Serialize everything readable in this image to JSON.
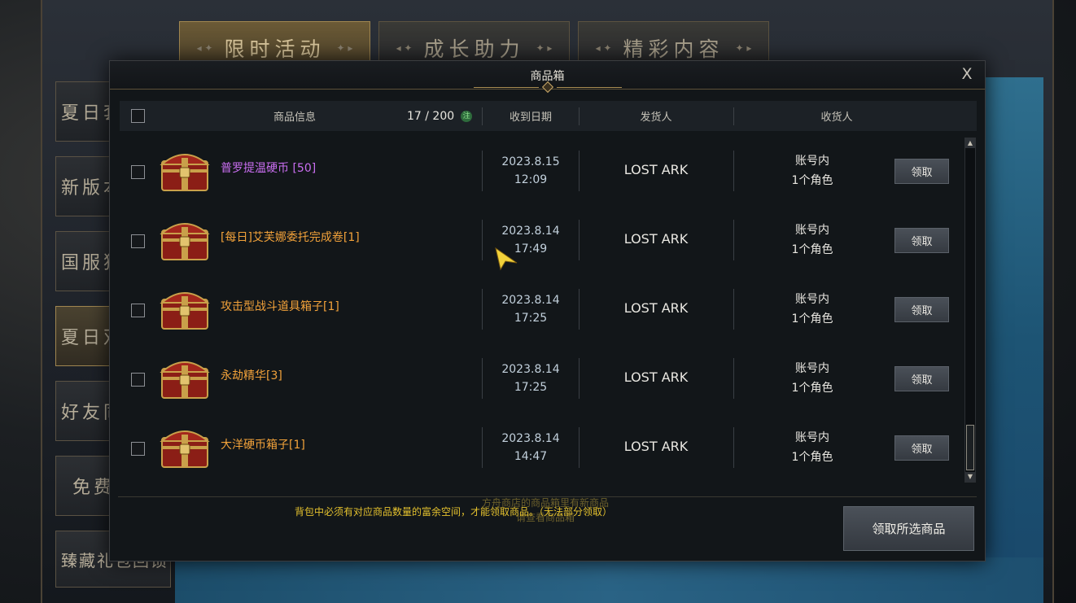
{
  "background": {
    "tabs": [
      {
        "label": "限时活动",
        "active": true
      },
      {
        "label": "成长助力",
        "active": false
      },
      {
        "label": "精彩内容",
        "active": false
      }
    ],
    "side_items": [
      {
        "label": "夏日套",
        "active": false
      },
      {
        "label": "新版本",
        "active": false
      },
      {
        "label": "国服独",
        "active": false
      },
      {
        "label": "夏日双",
        "active": true
      },
      {
        "label": "好友同",
        "active": false
      },
      {
        "label": "免费",
        "active": false
      },
      {
        "label": "臻藏礼包回馈",
        "active": false
      }
    ]
  },
  "modal": {
    "title": "商品箱",
    "close_label": "X",
    "columns": {
      "info": "商品信息",
      "count": "17 / 200",
      "count_note": "注",
      "date": "收到日期",
      "sender": "发货人",
      "receiver": "收货人"
    },
    "rows": [
      {
        "name": "普罗提温硬币 [50]",
        "color": "purple",
        "date": "2023.8.15",
        "time": "12:09",
        "sender": "LOST ARK",
        "receiver_line1": "账号内",
        "receiver_line2": "1个角色",
        "claim": "领取"
      },
      {
        "name": "[每日]艾芙娜委托完成卷[1]",
        "color": "orange",
        "date": "2023.8.14",
        "time": "17:49",
        "sender": "LOST ARK",
        "receiver_line1": "账号内",
        "receiver_line2": "1个角色",
        "claim": "领取"
      },
      {
        "name": "攻击型战斗道具箱子[1]",
        "color": "orange",
        "date": "2023.8.14",
        "time": "17:25",
        "sender": "LOST ARK",
        "receiver_line1": "账号内",
        "receiver_line2": "1个角色",
        "claim": "领取"
      },
      {
        "name": "永劫精华[3]",
        "color": "orange",
        "date": "2023.8.14",
        "time": "17:25",
        "sender": "LOST ARK",
        "receiver_line1": "账号内",
        "receiver_line2": "1个角色",
        "claim": "领取"
      },
      {
        "name": "大洋硬币箱子[1]",
        "color": "orange",
        "date": "2023.8.14",
        "time": "14:47",
        "sender": "LOST ARK",
        "receiver_line1": "账号内",
        "receiver_line2": "1个角色",
        "claim": "领取"
      }
    ],
    "footer_message": "背包中必须有对应商品数量的富余空间，才能领取商品。（无法部分领取）",
    "ghost_message_line1": "方舟商店的商品箱里有新商品",
    "ghost_message_line2": "请查看商品箱",
    "claim_all_label": "领取所选商品"
  },
  "colors": {
    "purple_item": "#c96ef0",
    "orange_item": "#f2a23a",
    "footer_text": "#e4c12e"
  }
}
